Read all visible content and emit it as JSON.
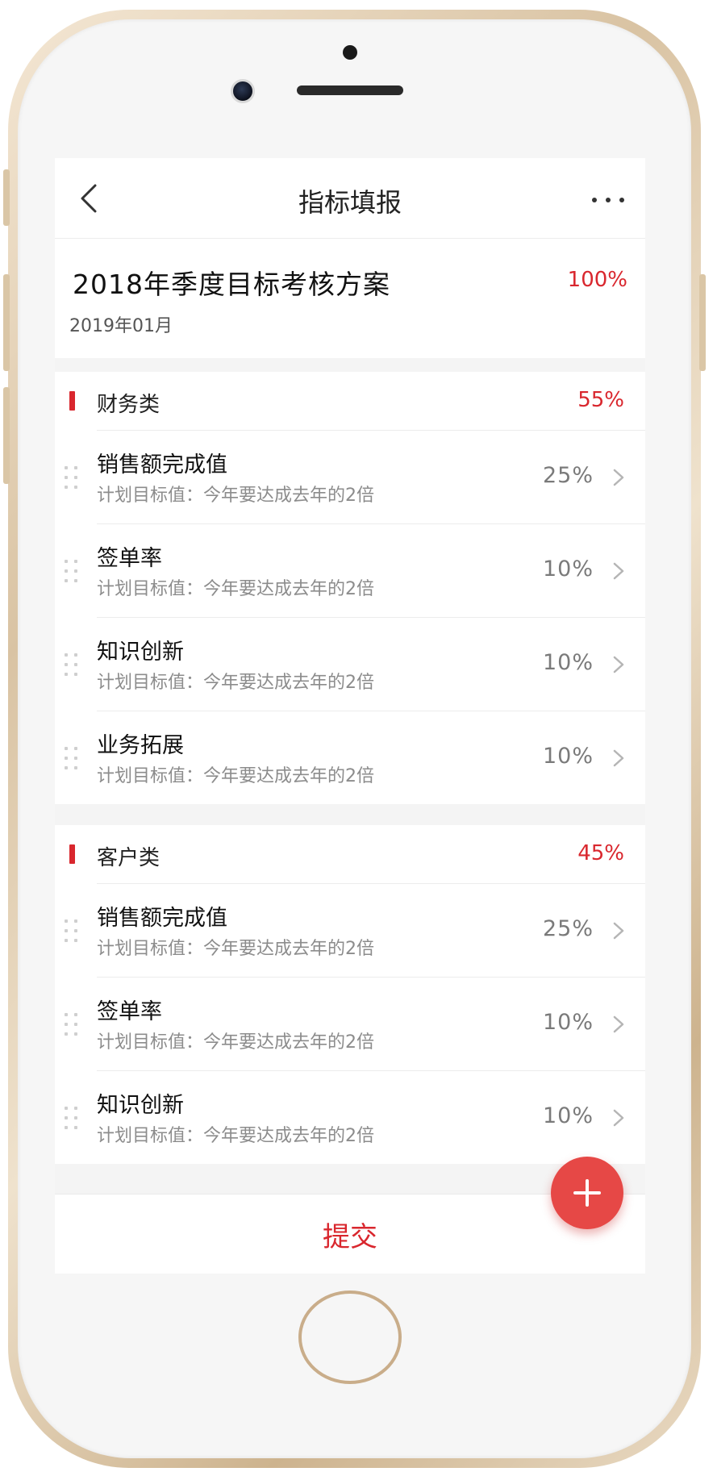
{
  "nav": {
    "title": "指标填报",
    "back_icon": "chevron-left-icon",
    "more_icon": "more-horizontal-icon"
  },
  "plan": {
    "title": "2018年季度目标考核方案",
    "percent": "100%",
    "date": "2019年01月"
  },
  "sections": [
    {
      "title": "财务类",
      "percent": "55%",
      "items": [
        {
          "title": "销售额完成值",
          "desc": "计划目标值：今年要达成去年的2倍",
          "percent": "25%"
        },
        {
          "title": "签单率",
          "desc": "计划目标值：今年要达成去年的2倍",
          "percent": "10%"
        },
        {
          "title": "知识创新",
          "desc": "计划目标值：今年要达成去年的2倍",
          "percent": "10%"
        },
        {
          "title": "业务拓展",
          "desc": "计划目标值：今年要达成去年的2倍",
          "percent": "10%"
        }
      ]
    },
    {
      "title": "客户类",
      "percent": "45%",
      "items": [
        {
          "title": "销售额完成值",
          "desc": "计划目标值：今年要达成去年的2倍",
          "percent": "25%"
        },
        {
          "title": "签单率",
          "desc": "计划目标值：今年要达成去年的2倍",
          "percent": "10%"
        },
        {
          "title": "知识创新",
          "desc": "计划目标值：今年要达成去年的2倍",
          "percent": "10%"
        }
      ]
    }
  ],
  "submit_label": "提交",
  "fab_icon": "plus-icon",
  "colors": {
    "accent": "#d9272e",
    "fab": "#e64846",
    "frame_gold": "#d9c3a3"
  }
}
